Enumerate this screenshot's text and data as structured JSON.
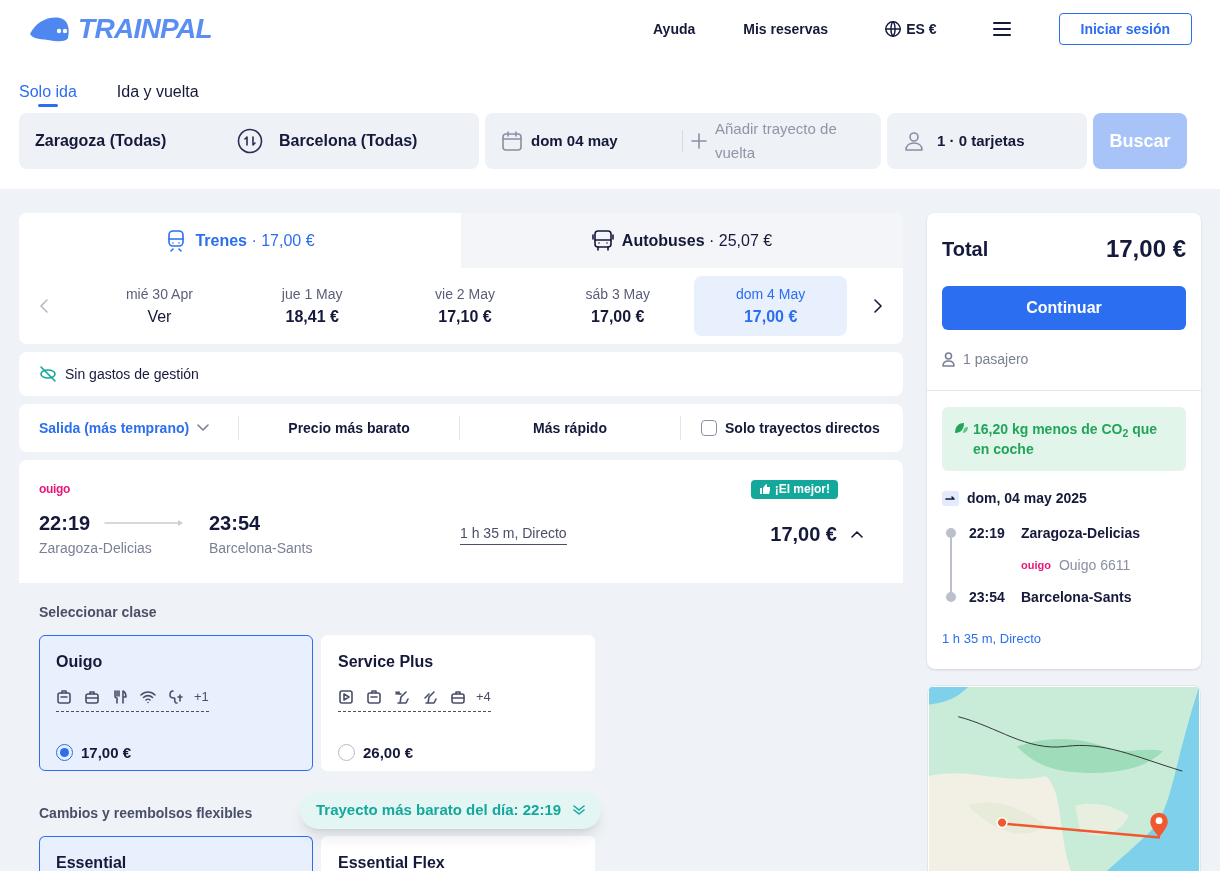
{
  "header": {
    "logo": "TRAINPAL",
    "nav": [
      "Ayuda",
      "Mis reservas"
    ],
    "locale": "ES €",
    "login": "Iniciar sesión"
  },
  "trip_tabs": [
    {
      "label": "Solo ida",
      "selected": true
    },
    {
      "label": "Ida y vuelta",
      "selected": false
    }
  ],
  "search": {
    "origin": "Zaragoza (Todas)",
    "destination": "Barcelona (Todas)",
    "date": "dom 04 may",
    "return_placeholder": "Añadir trayecto de vuelta",
    "passengers": "1 · 0 tarjetas",
    "button": "Buscar",
    "button_disabled": true
  },
  "mode_tabs": [
    {
      "kind": "train",
      "label": "Trenes",
      "price": "· 17,00 €",
      "selected": true
    },
    {
      "kind": "bus",
      "label": "Autobuses",
      "price": "· 25,07 €",
      "selected": false
    }
  ],
  "dates": [
    {
      "day": "mié 30 Apr",
      "price": "Ver",
      "selected": false
    },
    {
      "day": "jue 1 May",
      "price": "18,41 €",
      "selected": false
    },
    {
      "day": "vie 2 May",
      "price": "17,10 €",
      "selected": false
    },
    {
      "day": "sáb 3 May",
      "price": "17,00 €",
      "selected": false
    },
    {
      "day": "dom 4 May",
      "price": "17,00 €",
      "selected": true
    }
  ],
  "notice": "Sin gastos de gestión",
  "sort_options": [
    {
      "kind": "dropdown",
      "label": "Salida (más temprano)",
      "selected": true
    },
    {
      "kind": "option",
      "label": "Precio más barato",
      "selected": false
    },
    {
      "kind": "option",
      "label": "Más rápido",
      "selected": false
    }
  ],
  "direct_only": {
    "label": "Solo trayectos directos",
    "checked": false
  },
  "journey": {
    "operator": "ouigo",
    "badge": "¡El mejor!",
    "departure_time": "22:19",
    "departure_station": "Zaragoza-Delicias",
    "arrival_time": "23:54",
    "arrival_station": "Barcelona-Sants",
    "duration": "1 h 35 m, Directo",
    "price": "17,00 €",
    "expanded": true
  },
  "class_section": {
    "title": "Seleccionar clase",
    "classes": [
      {
        "name": "Ouigo",
        "amenities": [
          {
            "kind": "luggage"
          },
          {
            "kind": "bag"
          },
          {
            "kind": "dining"
          },
          {
            "kind": "wifi"
          },
          {
            "kind": "plug"
          }
        ],
        "more": "+1",
        "price": "17,00 €",
        "selected": true
      },
      {
        "name": "Service Plus",
        "amenities": [
          {
            "kind": "video"
          },
          {
            "kind": "luggage"
          },
          {
            "kind": "seat_xl"
          },
          {
            "kind": "seat"
          },
          {
            "kind": "bag"
          }
        ],
        "more": "+4",
        "price": "26,00 €",
        "selected": false
      }
    ]
  },
  "flex_section": {
    "title": "Cambios y reembolsos flexibles",
    "options": [
      {
        "name": "Essential",
        "selected": true
      },
      {
        "name": "Essential Flex",
        "selected": false
      }
    ]
  },
  "toast": "Trayecto más barato del día: 22:19",
  "summary": {
    "total_label": "Total",
    "total": "17,00 €",
    "button": "Continuar",
    "passengers": "1 pasajero",
    "co2": "16,20 kg menos de CO$_{2}$ que en coche",
    "date": "dom, 04 may 2025",
    "stops": [
      {
        "time": "22:19",
        "station": "Zaragoza-Delicias"
      },
      {
        "time": "23:54",
        "station": "Barcelona-Sants"
      }
    ],
    "operator": "ouigo",
    "train": "Ouigo 6611",
    "duration": "1 h 35 m, Directo"
  }
}
